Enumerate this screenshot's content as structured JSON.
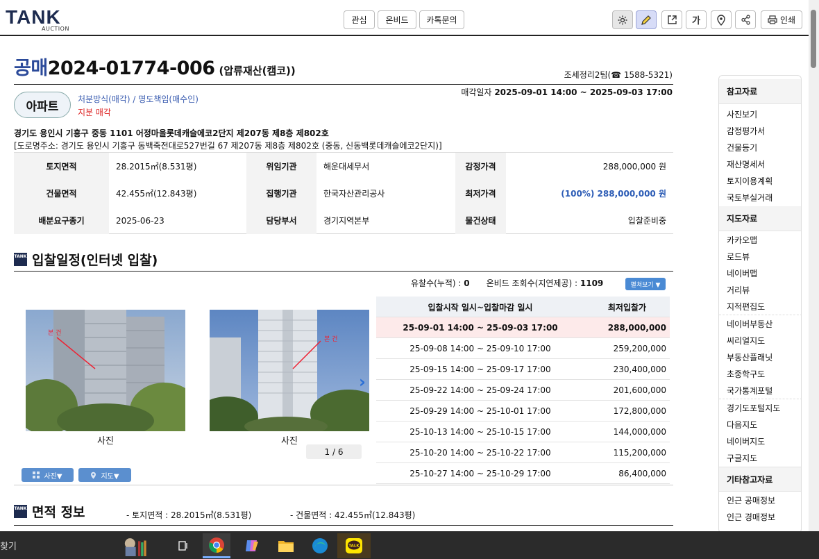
{
  "header": {
    "logo": "TANK",
    "logo_sub": "AUCTION",
    "buttons": [
      "관심",
      "온비드",
      "카톡문의"
    ],
    "print_label": "인쇄",
    "font_button_label": "가"
  },
  "title": {
    "prefix": "공매",
    "number": "2024-01774-006",
    "sub": "(압류재산(캠코))",
    "team": "조세정리2팀(☎ 1588-5321)"
  },
  "property": {
    "type": "아파트",
    "dispose": "처분방식(매각) / 명도책임(매수인)",
    "share": "지분 매각",
    "sale_date_label": "매각일자",
    "sale_date_value": "2025-09-01 14:00 ~ 2025-09-03 17:00",
    "address": "경기도 용인시 기흥구 중동 1101 어정마을롯데캐슬에코2단지 제207동 제8층 제802호",
    "road_address": "[도로명주소: 경기도 용인시 기흥구 동백죽전대로527번길 67 제207동 제8층 제802호 (중동, 신동백롯데캐슬에코2단지)]"
  },
  "info_table": {
    "rows": [
      [
        {
          "h": "토지면적",
          "v": "28.2015㎡(8.531평)"
        },
        {
          "h": "위임기관",
          "v": "해운대세무서"
        },
        {
          "h": "감정가격",
          "v": "288,000,000 원"
        }
      ],
      [
        {
          "h": "건물면적",
          "v": "42.455㎡(12.843평)"
        },
        {
          "h": "집행기관",
          "v": "한국자산관리공사"
        },
        {
          "h": "최저가격",
          "v": "(100%) 288,000,000 원"
        }
      ],
      [
        {
          "h": "배분요구종기",
          "v": "2025-06-23"
        },
        {
          "h": "담당부서",
          "v": "경기지역본부"
        },
        {
          "h": "물건상태",
          "v": "입찰준비중"
        }
      ]
    ]
  },
  "schedule_section": {
    "icon_text": "TANK",
    "title": "입찰일정(인터넷 입찰)",
    "fail_label": "유찰수(누적) :",
    "fail_count": "0",
    "views_label": "온비드 조회수(지연제공) :",
    "views_count": "1109",
    "expand_label": "펼쳐보기 ▼",
    "headers": [
      "입찰시작 일시~입찰마감 일시",
      "최저입찰가"
    ],
    "rows": [
      {
        "date": "25-09-01 14:00 ~ 25-09-03 17:00",
        "price": "288,000,000"
      },
      {
        "date": "25-09-08 14:00 ~ 25-09-10 17:00",
        "price": "259,200,000"
      },
      {
        "date": "25-09-15 14:00 ~ 25-09-17 17:00",
        "price": "230,400,000"
      },
      {
        "date": "25-09-22 14:00 ~ 25-09-24 17:00",
        "price": "201,600,000"
      },
      {
        "date": "25-09-29 14:00 ~ 25-10-01 17:00",
        "price": "172,800,000"
      },
      {
        "date": "25-10-13 14:00 ~ 25-10-15 17:00",
        "price": "144,000,000"
      },
      {
        "date": "25-10-20 14:00 ~ 25-10-22 17:00",
        "price": "115,200,000"
      },
      {
        "date": "25-10-27 14:00 ~ 25-10-29 17:00",
        "price": "86,400,000"
      }
    ]
  },
  "photos": {
    "captions": [
      "사진",
      "사진"
    ],
    "marker_text": "본 건",
    "pager": "1 / 6",
    "photo_button": "사진▼",
    "map_button": "지도▼"
  },
  "area_section": {
    "icon_text": "TANK",
    "title": "면적 정보",
    "land": "- 토지면적 : 28.2015㎡(8.531평)",
    "building": "- 건물면적 : 42.455㎡(12.843평)"
  },
  "sidebar": {
    "ref_title": "참고자료",
    "ref_items": [
      "사진보기",
      "감정평가서",
      "건물등기",
      "재산명세서",
      "토지이용계획",
      "국토부실거래"
    ],
    "map_title": "지도자료",
    "map_items_a": [
      "카카오맵",
      "로드뷰",
      "네이버맵",
      "거리뷰",
      "지적편집도"
    ],
    "map_items_b": [
      "네이버부동산",
      "씨리얼지도",
      "부동산플래닛",
      "초중학구도",
      "국가통계포털"
    ],
    "map_items_c": [
      "경기도포털지도",
      "다음지도",
      "네이버지도",
      "구글지도"
    ],
    "etc_title": "기타참고자료",
    "etc_items": [
      "인근 공매정보",
      "인근 경매정보"
    ]
  },
  "taskbar": {
    "search_text": "찾기",
    "kakao_label": "TALK"
  }
}
